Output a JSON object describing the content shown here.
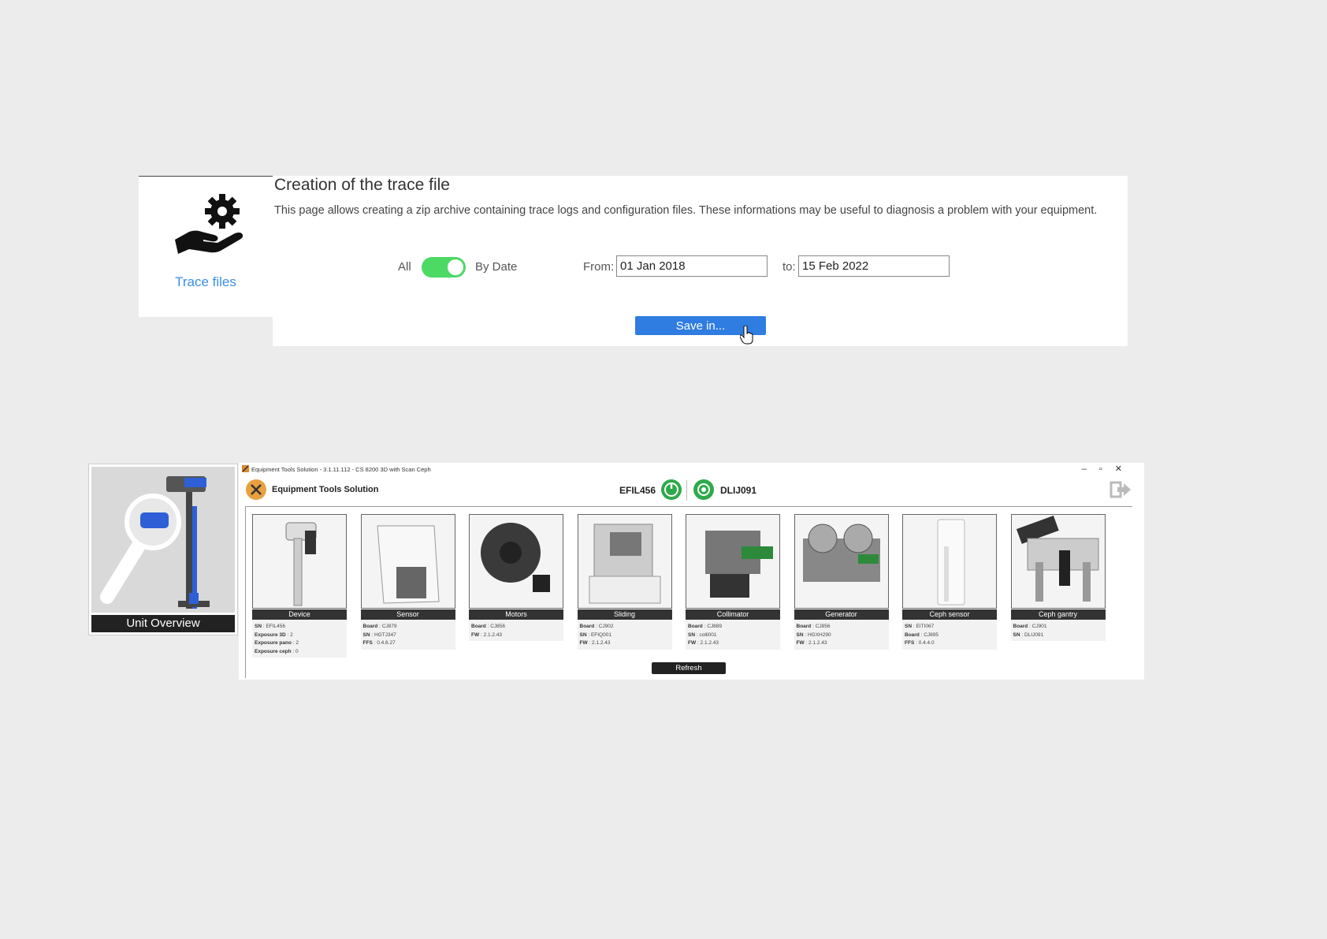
{
  "trace": {
    "tile_label": "Trace files",
    "title": "Creation of the trace file",
    "description": "This page allows creating a zip archive containing trace logs and configuration files. These informations may be useful to diagnosis a problem with your equipment.",
    "toggle_left": "All",
    "toggle_right": "By Date",
    "toggle_on": true,
    "from_label": "From:",
    "from_value": "01 Jan 2018",
    "to_label": "to:",
    "to_value": "15 Feb 2022",
    "save_label": "Save in..."
  },
  "unit_tile": {
    "label": "Unit Overview"
  },
  "window": {
    "title": "Equipment Tools Solution - 3.1.11.112 - CS 8200 3D with Scan Ceph",
    "app_name": "Equipment Tools Solution",
    "device_primary": "EFIL456",
    "device_secondary": "DLIJ091",
    "refresh_label": "Refresh",
    "components": [
      {
        "name": "Device",
        "lines": [
          [
            "SN",
            "EFIL456"
          ],
          [
            "Exposure 3D",
            "2"
          ],
          [
            "Exposure pano",
            "2"
          ],
          [
            "Exposure ceph",
            "0"
          ]
        ]
      },
      {
        "name": "Sensor",
        "lines": [
          [
            "Board",
            "CJ879"
          ],
          [
            "SN",
            "HGTJ347"
          ],
          [
            "FFS",
            "0.4.6.27"
          ]
        ]
      },
      {
        "name": "Motors",
        "lines": [
          [
            "Board",
            "CJ856"
          ],
          [
            "FW",
            "2.1.2.43"
          ]
        ]
      },
      {
        "name": "Sliding",
        "lines": [
          [
            "Board",
            "CJ902"
          ],
          [
            "SN",
            "EFIQ001"
          ],
          [
            "FW",
            "2.1.2.43"
          ]
        ]
      },
      {
        "name": "Collimator",
        "lines": [
          [
            "Board",
            "CJ889"
          ],
          [
            "SN",
            "colli001"
          ],
          [
            "FW",
            "2.1.2.43"
          ]
        ]
      },
      {
        "name": "Generator",
        "lines": [
          [
            "Board",
            "CJ856"
          ],
          [
            "SN",
            "HGXH290"
          ],
          [
            "FW",
            "2.1.2.43"
          ]
        ]
      },
      {
        "name": "Ceph sensor",
        "lines": [
          [
            "SN",
            "EITI067"
          ],
          [
            "Board",
            "CJ895"
          ],
          [
            "FFS",
            "0.4.4.0"
          ]
        ]
      },
      {
        "name": "Ceph gantry",
        "lines": [
          [
            "Board",
            "CJ901"
          ],
          [
            "SN",
            "DLIJ091"
          ]
        ]
      }
    ]
  },
  "colors": {
    "accent_blue": "#2f7de1",
    "link_blue": "#3a8ee6",
    "toggle_green": "#4cd964",
    "status_green": "#2eaa4a"
  }
}
